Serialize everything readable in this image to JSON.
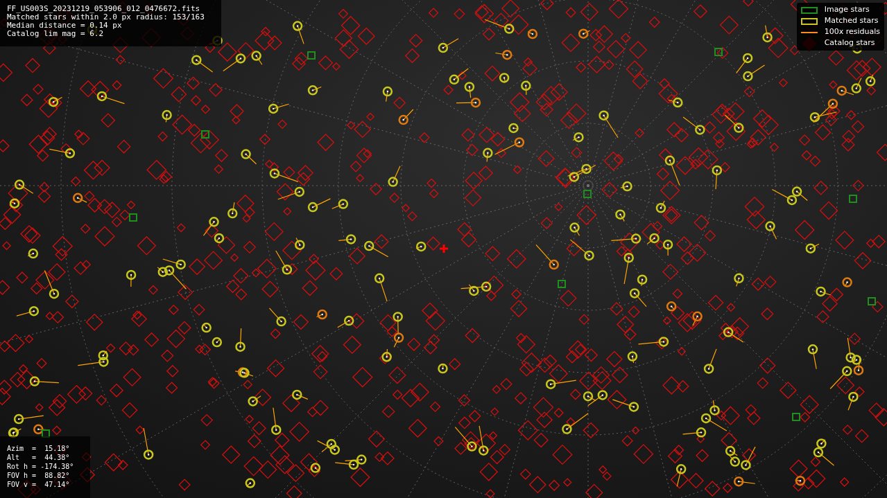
{
  "info_panel": {
    "lines": [
      "FF_US003S_20231219_053906_012_0476672.fits",
      "Matched stars within 2.0 px radius: 153/163",
      "Median distance = 0.14 px",
      "Catalog lim mag = 6.2"
    ]
  },
  "legend": {
    "items": [
      {
        "kind": "rect",
        "label": "Image stars",
        "color": "#1f8f1f"
      },
      {
        "kind": "rect",
        "label": "Matched stars",
        "color": "#c8c81e"
      },
      {
        "kind": "line",
        "label": "100x residuals",
        "color": "#ff8c1a"
      },
      {
        "kind": "diamond",
        "label": "Catalog stars",
        "color": "#1a0000"
      }
    ]
  },
  "pointing_panel": {
    "lines": [
      "Azim  =  15.18°",
      "Alt   =  44.38°",
      "Rot h = -174.38°",
      "FOV h =  88.82°",
      "FOV v =  47.14°"
    ]
  }
}
